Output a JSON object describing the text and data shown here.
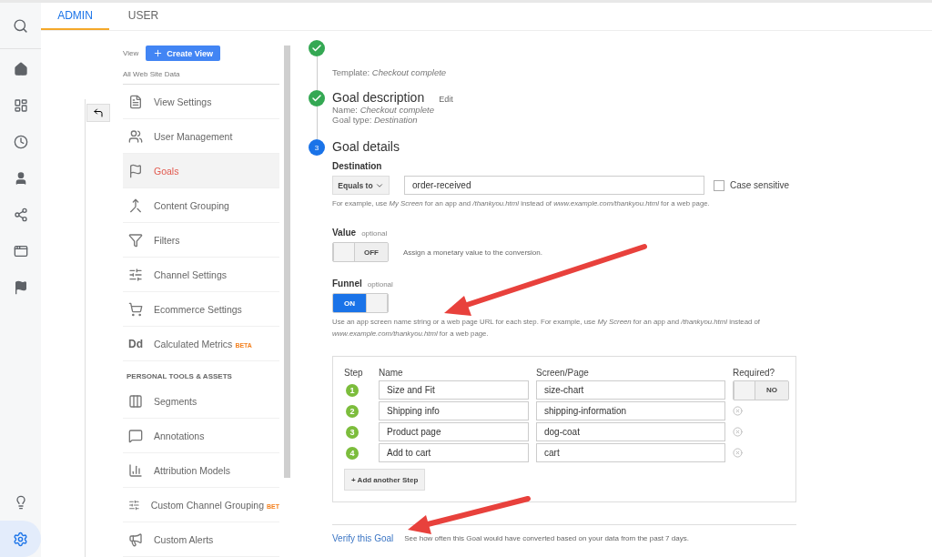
{
  "tabs": [
    {
      "label": "ADMIN",
      "selected": true
    },
    {
      "label": "USER",
      "selected": false
    }
  ],
  "view": {
    "label": "View",
    "create_button": "Create View",
    "name": "All Web Site Data"
  },
  "menu": [
    {
      "label": "View Settings",
      "selected": false
    },
    {
      "label": "User Management",
      "selected": false
    },
    {
      "label": "Goals",
      "selected": true
    },
    {
      "label": "Content Grouping",
      "selected": false
    },
    {
      "label": "Filters",
      "selected": false
    },
    {
      "label": "Channel Settings",
      "selected": false
    },
    {
      "label": "Ecommerce Settings",
      "selected": false
    },
    {
      "label": "Calculated Metrics",
      "badge": "BETA",
      "icon_text": "Dd",
      "selected": false
    },
    {
      "kind": "header",
      "label": "PERSONAL TOOLS & ASSETS"
    },
    {
      "label": "Segments",
      "selected": false
    },
    {
      "label": "Annotations",
      "selected": false
    },
    {
      "label": "Attribution Models",
      "selected": false
    },
    {
      "label": "Custom Channel Grouping",
      "badge": "BET",
      "selected": false
    },
    {
      "label": "Custom Alerts",
      "selected": false
    }
  ],
  "steps": [
    {
      "completed": true,
      "lines": [
        "Template: *Checkout complete*"
      ]
    },
    {
      "completed": true,
      "title": "Goal description",
      "edit": "Edit",
      "lines": [
        "Name: *Checkout complete*",
        "Goal type: *Destination*"
      ]
    },
    {
      "completed": false,
      "number": "3",
      "title": "Goal details"
    }
  ],
  "destination": {
    "label": "Destination",
    "match": "Equals to",
    "value": "order-received",
    "case_sensitive": {
      "label": "Case sensitive",
      "checked": false
    },
    "help": "For example, use *My Screen* for an app and */thankyou.html* instead of *www.example.com/thankyou.html* for a web page."
  },
  "value": {
    "label": "Value",
    "optional": "optional",
    "toggle": {
      "on": false,
      "label": "OFF"
    },
    "help": "Assign a monetary value to the conversion."
  },
  "funnel": {
    "label": "Funnel",
    "optional": "optional",
    "toggle": {
      "on": true,
      "label": "ON"
    },
    "help": "Use an app screen name string or a web page URL for each step. For example, use *My Screen* for an app and */thankyou.html* instead of *www.example.com/thankyou.html* for a web page.",
    "columns": [
      "Step",
      "Name",
      "Screen/Page",
      "Required?"
    ],
    "rows": [
      {
        "step": "1",
        "name": "Size and Fit",
        "page": "size-chart",
        "required": {
          "on": false,
          "label": "NO"
        }
      },
      {
        "step": "2",
        "name": "Shipping info",
        "page": "shipping-information"
      },
      {
        "step": "3",
        "name": "Product page",
        "page": "dog-coat"
      },
      {
        "step": "4",
        "name": "Add to cart",
        "page": "cart"
      }
    ],
    "add_button": "+ Add another Step"
  },
  "verify": {
    "link": "Verify this Goal",
    "text": "See how often this Goal would have converted based on your data from the past 7 days."
  }
}
